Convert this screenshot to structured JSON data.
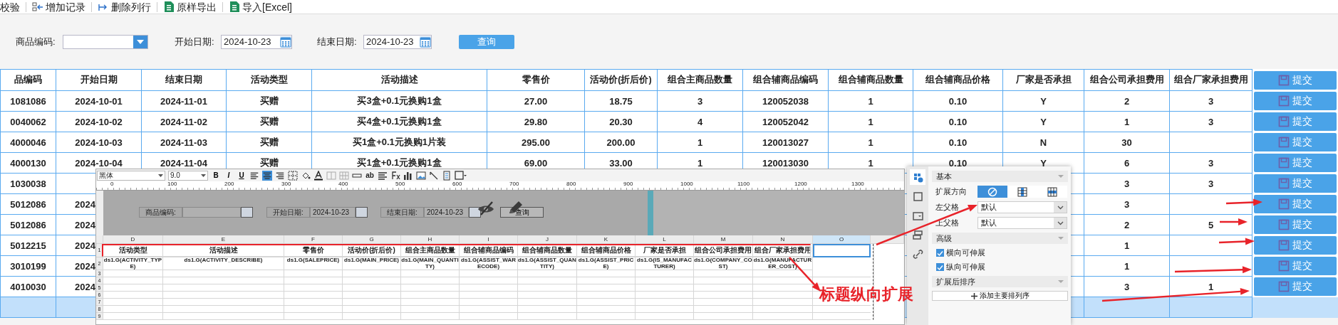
{
  "toolbar": [
    {
      "label": "校验",
      "kind": "plain"
    },
    {
      "label": "增加记录",
      "kind": "add"
    },
    {
      "label": "删除列行",
      "kind": "delete"
    },
    {
      "label": "原样导出",
      "kind": "export"
    },
    {
      "label": "导入[Excel]",
      "kind": "import"
    }
  ],
  "filters": {
    "product_code": {
      "label": "商品编码:"
    },
    "start_date": {
      "label": "开始日期:",
      "value": "2024-10-23"
    },
    "end_date": {
      "label": "结束日期:",
      "value": "2024-10-23"
    },
    "query_button": "查询"
  },
  "table": {
    "columns": [
      "品编码",
      "开始日期",
      "结束日期",
      "活动类型",
      "活动描述",
      "零售价",
      "活动价(折后价)",
      "组合主商品数量",
      "组合辅商品编码",
      "组合辅商品数量",
      "组合辅商品价格",
      "厂家是否承担",
      "组合公司承担费用",
      "组合厂家承担费用"
    ],
    "action_header": "提交",
    "rows": [
      {
        "selected": false,
        "code": "1081086",
        "start_date": "2024-10-01",
        "end_date": "2024-11-01",
        "activity_type": "买赠",
        "description": "买3盒+0.1元换购1盒",
        "retail_price": "27.00",
        "activity_price": "18.75",
        "main_qty": "3",
        "assist_code": "120052038",
        "assist_qty": "1",
        "assist_price": "0.10",
        "manufacturer_bears": "Y",
        "company_cost": "2",
        "manufacturer_cost": "3",
        "action": "提交"
      },
      {
        "selected": false,
        "code": "0040062",
        "start_date": "2024-10-02",
        "end_date": "2024-11-02",
        "activity_type": "买赠",
        "description": "买4盒+0.1元换购1盒",
        "retail_price": "29.80",
        "activity_price": "20.30",
        "main_qty": "4",
        "assist_code": "120052042",
        "assist_qty": "1",
        "assist_price": "0.10",
        "manufacturer_bears": "Y",
        "company_cost": "1",
        "manufacturer_cost": "3",
        "action": "提交"
      },
      {
        "selected": false,
        "code": "4000046",
        "start_date": "2024-10-03",
        "end_date": "2024-11-03",
        "activity_type": "买赠",
        "description": "买1盒+0.1元换购1片装",
        "retail_price": "295.00",
        "activity_price": "200.00",
        "main_qty": "1",
        "assist_code": "120013027",
        "assist_qty": "1",
        "assist_price": "0.10",
        "manufacturer_bears": "N",
        "company_cost": "30",
        "action": "提交"
      },
      {
        "selected": false,
        "code": "4000130",
        "start_date": "2024-10-04",
        "end_date": "2024-11-04",
        "activity_type": "买赠",
        "description": "买1盒+0.1元换购1盒",
        "retail_price": "69.00",
        "activity_price": "33.00",
        "main_qty": "1",
        "assist_code": "120013030",
        "assist_qty": "1",
        "assist_price": "0.10",
        "manufacturer_bears": "Y",
        "company_cost": "6",
        "manufacturer_cost": "3",
        "action": "提交"
      },
      {
        "selected": false,
        "code": "1030038",
        "company_cost": "3",
        "manufacturer_cost": "3",
        "action": "提交"
      },
      {
        "selected": false,
        "code": "5012086",
        "start_date": "2024",
        "company_cost": "3",
        "action": "提交"
      },
      {
        "selected": false,
        "code": "5012086",
        "start_date": "2024",
        "company_cost": "2",
        "manufacturer_cost": "5",
        "action": "提交"
      },
      {
        "selected": false,
        "code": "5012215",
        "start_date": "2024",
        "company_cost": "1",
        "action": "提交"
      },
      {
        "selected": false,
        "code": "3010199",
        "start_date": "2024",
        "company_cost": "1",
        "action": "提交"
      },
      {
        "selected": false,
        "code": "4010030",
        "start_date": "2024",
        "company_cost": "3",
        "manufacturer_cost": "1",
        "action": "提交"
      },
      {
        "selected": true
      }
    ]
  },
  "designer": {
    "toolbar": {
      "font": "黑体",
      "size": "9.0",
      "bold": "B",
      "italic": "I",
      "underline": "U",
      "text_tool": "ab",
      "align_options": [
        {
          "kind": "left",
          "selected": false
        },
        {
          "kind": "center",
          "selected": true
        },
        {
          "kind": "right",
          "selected": false
        }
      ]
    },
    "ruler": [
      "0",
      "100",
      "200",
      "300",
      "400",
      "500",
      "600",
      "700",
      "800",
      "900",
      "1000",
      "1100",
      "1200",
      "1300"
    ],
    "form": {
      "product_label": "商品编码:",
      "start_label": "开始日期:",
      "start_value": "2024-10-23",
      "end_label": "结束日期:",
      "end_value": "2024-10-23",
      "query": "查询"
    },
    "grid": {
      "columns": [
        {
          "letter": "D",
          "selected": false
        },
        {
          "letter": "E",
          "selected": false
        },
        {
          "letter": "F",
          "selected": false
        },
        {
          "letter": "G",
          "selected": false
        },
        {
          "letter": "H",
          "selected": false
        },
        {
          "letter": "I",
          "selected": false
        },
        {
          "letter": "J",
          "selected": false
        },
        {
          "letter": "K",
          "selected": false
        },
        {
          "letter": "L",
          "selected": false
        },
        {
          "letter": "M",
          "selected": false
        },
        {
          "letter": "N",
          "selected": false
        },
        {
          "letter": "O",
          "selected": true
        }
      ],
      "row_numbers": [
        "1",
        "2",
        "3",
        "4",
        "5",
        "6",
        "7",
        "8",
        "9"
      ],
      "header_cells": [
        "活动类型",
        "活动描述",
        "零售价",
        "活动价(折后价)",
        "组合主商品数量",
        "组合辅商品编码",
        "组合辅商品数量",
        "组合辅商品价格",
        "厂家是否承担",
        "组合公司承担费用",
        "组合厂家承担费用"
      ],
      "field_cells": [
        "ds1.G(ACTIVITY_TYPE)",
        "ds1.G(ACTIVITY_DESCRIBE)",
        "ds1.G(SALEPRICE)",
        "ds1.G(MAIN_PRICE)",
        "ds1.G(MAIN_QUANTITY)",
        "ds1.G(ASSIST_WARECODE)",
        "ds1.G(ASSIST_QUANTITY)",
        "ds1.G(ASSIST_PRICE)",
        "ds1.G(IS_MANUFACTURER)",
        "ds1.G(COMPANY_COST)",
        "ds1.G(MANUFACTURER_COST)"
      ]
    }
  },
  "properties": {
    "tabs": [
      {
        "kind": "grid",
        "selected": true
      },
      {
        "kind": "square",
        "selected": false
      },
      {
        "kind": "window",
        "selected": false
      },
      {
        "kind": "layers",
        "selected": false
      },
      {
        "kind": "link",
        "selected": false
      }
    ],
    "basic": "基本",
    "expand_direction": {
      "label": "扩展方向",
      "options": [
        {
          "kind": "none",
          "selected": true
        },
        {
          "kind": "vertical",
          "selected": false
        },
        {
          "kind": "horizontal",
          "selected": false
        }
      ]
    },
    "left_parent": {
      "label": "左父格",
      "value": "默认"
    },
    "top_parent": {
      "label": "上父格",
      "value": "默认"
    },
    "advanced": "高级",
    "checks": [
      {
        "label": "横向可伸展",
        "checked": true
      },
      {
        "label": "纵向可伸展",
        "checked": true
      }
    ],
    "sort_section": "扩展后排序",
    "add_sort_button": "添加主要排列序"
  },
  "annotation": "标题纵向扩展"
}
